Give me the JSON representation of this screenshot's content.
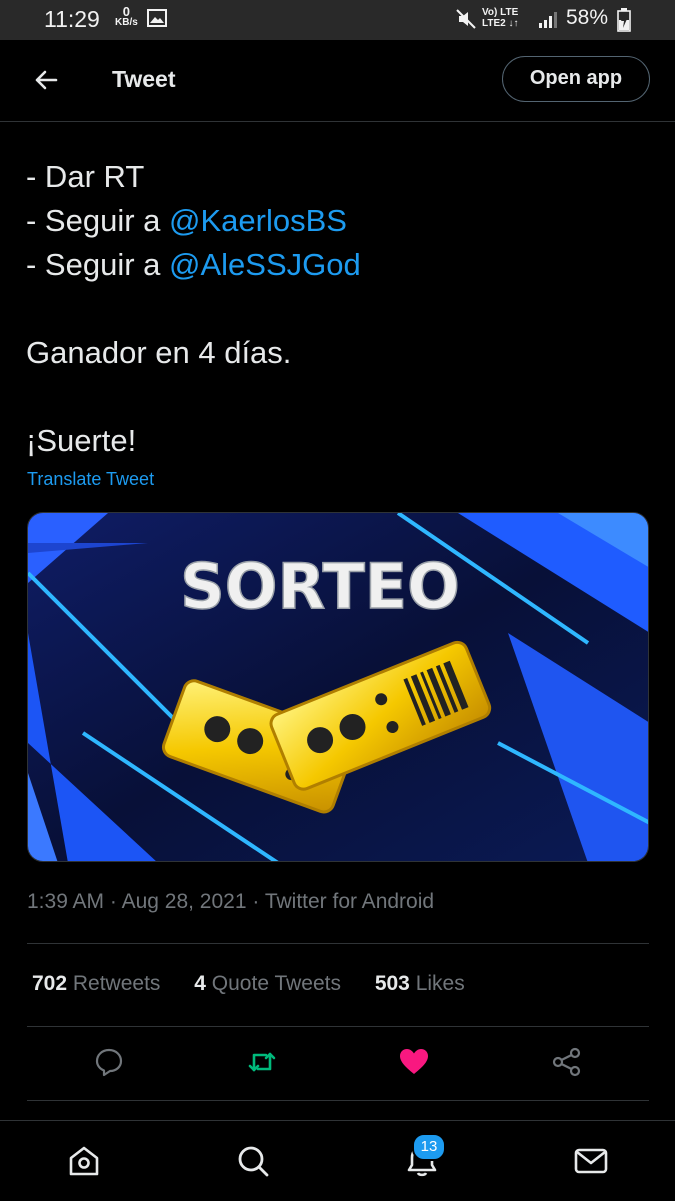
{
  "status_bar": {
    "time": "11:29",
    "kbs_value": "0",
    "kbs_unit": "KB/s",
    "network_top": "Vo) LTE",
    "network_bottom": "LTE2 ↓↑",
    "battery": "58%"
  },
  "header": {
    "title": "Tweet",
    "open_app_label": "Open app"
  },
  "tweet": {
    "lines": [
      "- Dar RT",
      "- Seguir a ",
      "- Seguir a ",
      "Ganador en 4 días.",
      "¡Suerte!"
    ],
    "mention1": "@KaerlosBS",
    "mention2": "@AleSSJGod",
    "translate_label": "Translate Tweet",
    "image_title": "SORTEO",
    "time": "1:39 AM",
    "date": "Aug 28, 2021",
    "source": "Twitter for Android",
    "separator": " · "
  },
  "stats": {
    "retweets_count": "702",
    "retweets_label": " Retweets",
    "quotes_count": "4",
    "quotes_label": " Quote Tweets",
    "likes_count": "503",
    "likes_label": " Likes"
  },
  "nav": {
    "notifications_badge": "13"
  },
  "colors": {
    "accent": "#1d9bf0",
    "retweet": "#00ba7c",
    "like": "#f91880"
  }
}
